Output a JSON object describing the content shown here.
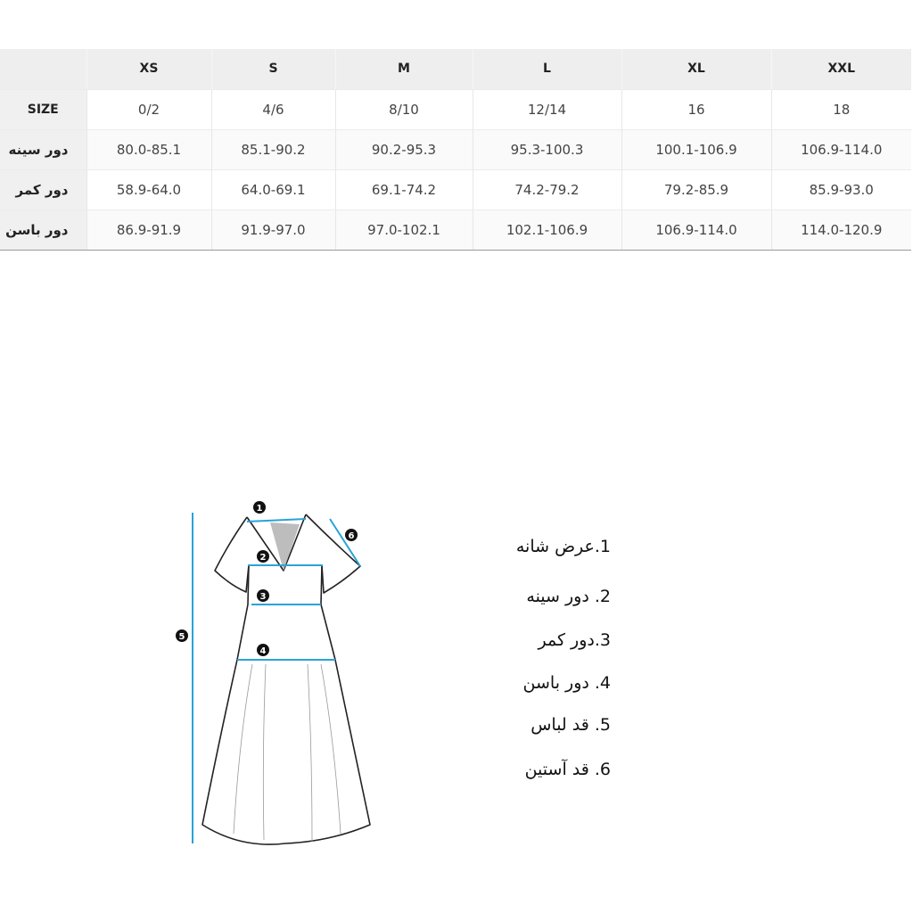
{
  "table": {
    "columns": [
      "XS",
      "S",
      "M",
      "L",
      "XL",
      "XXL"
    ],
    "size_row": {
      "label": "SIZE",
      "values": [
        "0/2",
        "4/6",
        "8/10",
        "12/14",
        "16",
        "18"
      ]
    },
    "rows": [
      {
        "label": "دور سینه",
        "values": [
          "80.0-85.1",
          "85.1-90.2",
          "90.2-95.3",
          "95.3-100.3",
          "100.1-106.9",
          "106.9-114.0"
        ]
      },
      {
        "label": "دور کمر",
        "values": [
          "58.9-64.0",
          "64.0-69.1",
          "69.1-74.2",
          "74.2-79.2",
          "79.2-85.9",
          "85.9-93.0"
        ]
      },
      {
        "label": "دور باسن",
        "values": [
          "86.9-91.9",
          "91.9-97.0",
          "97.0-102.1",
          "102.1-106.9",
          "106.9-114.0",
          "114.0-120.9"
        ]
      }
    ]
  },
  "figure": {
    "markers": [
      "1",
      "2",
      "3",
      "4",
      "5",
      "6"
    ],
    "line_color": "#29a3d8"
  },
  "legend": [
    "1.عرض شانه",
    "2. دور سینه",
    "3.دور کمر",
    "4. دور باسن",
    "5. قد لباس",
    "6. قد آستین"
  ]
}
